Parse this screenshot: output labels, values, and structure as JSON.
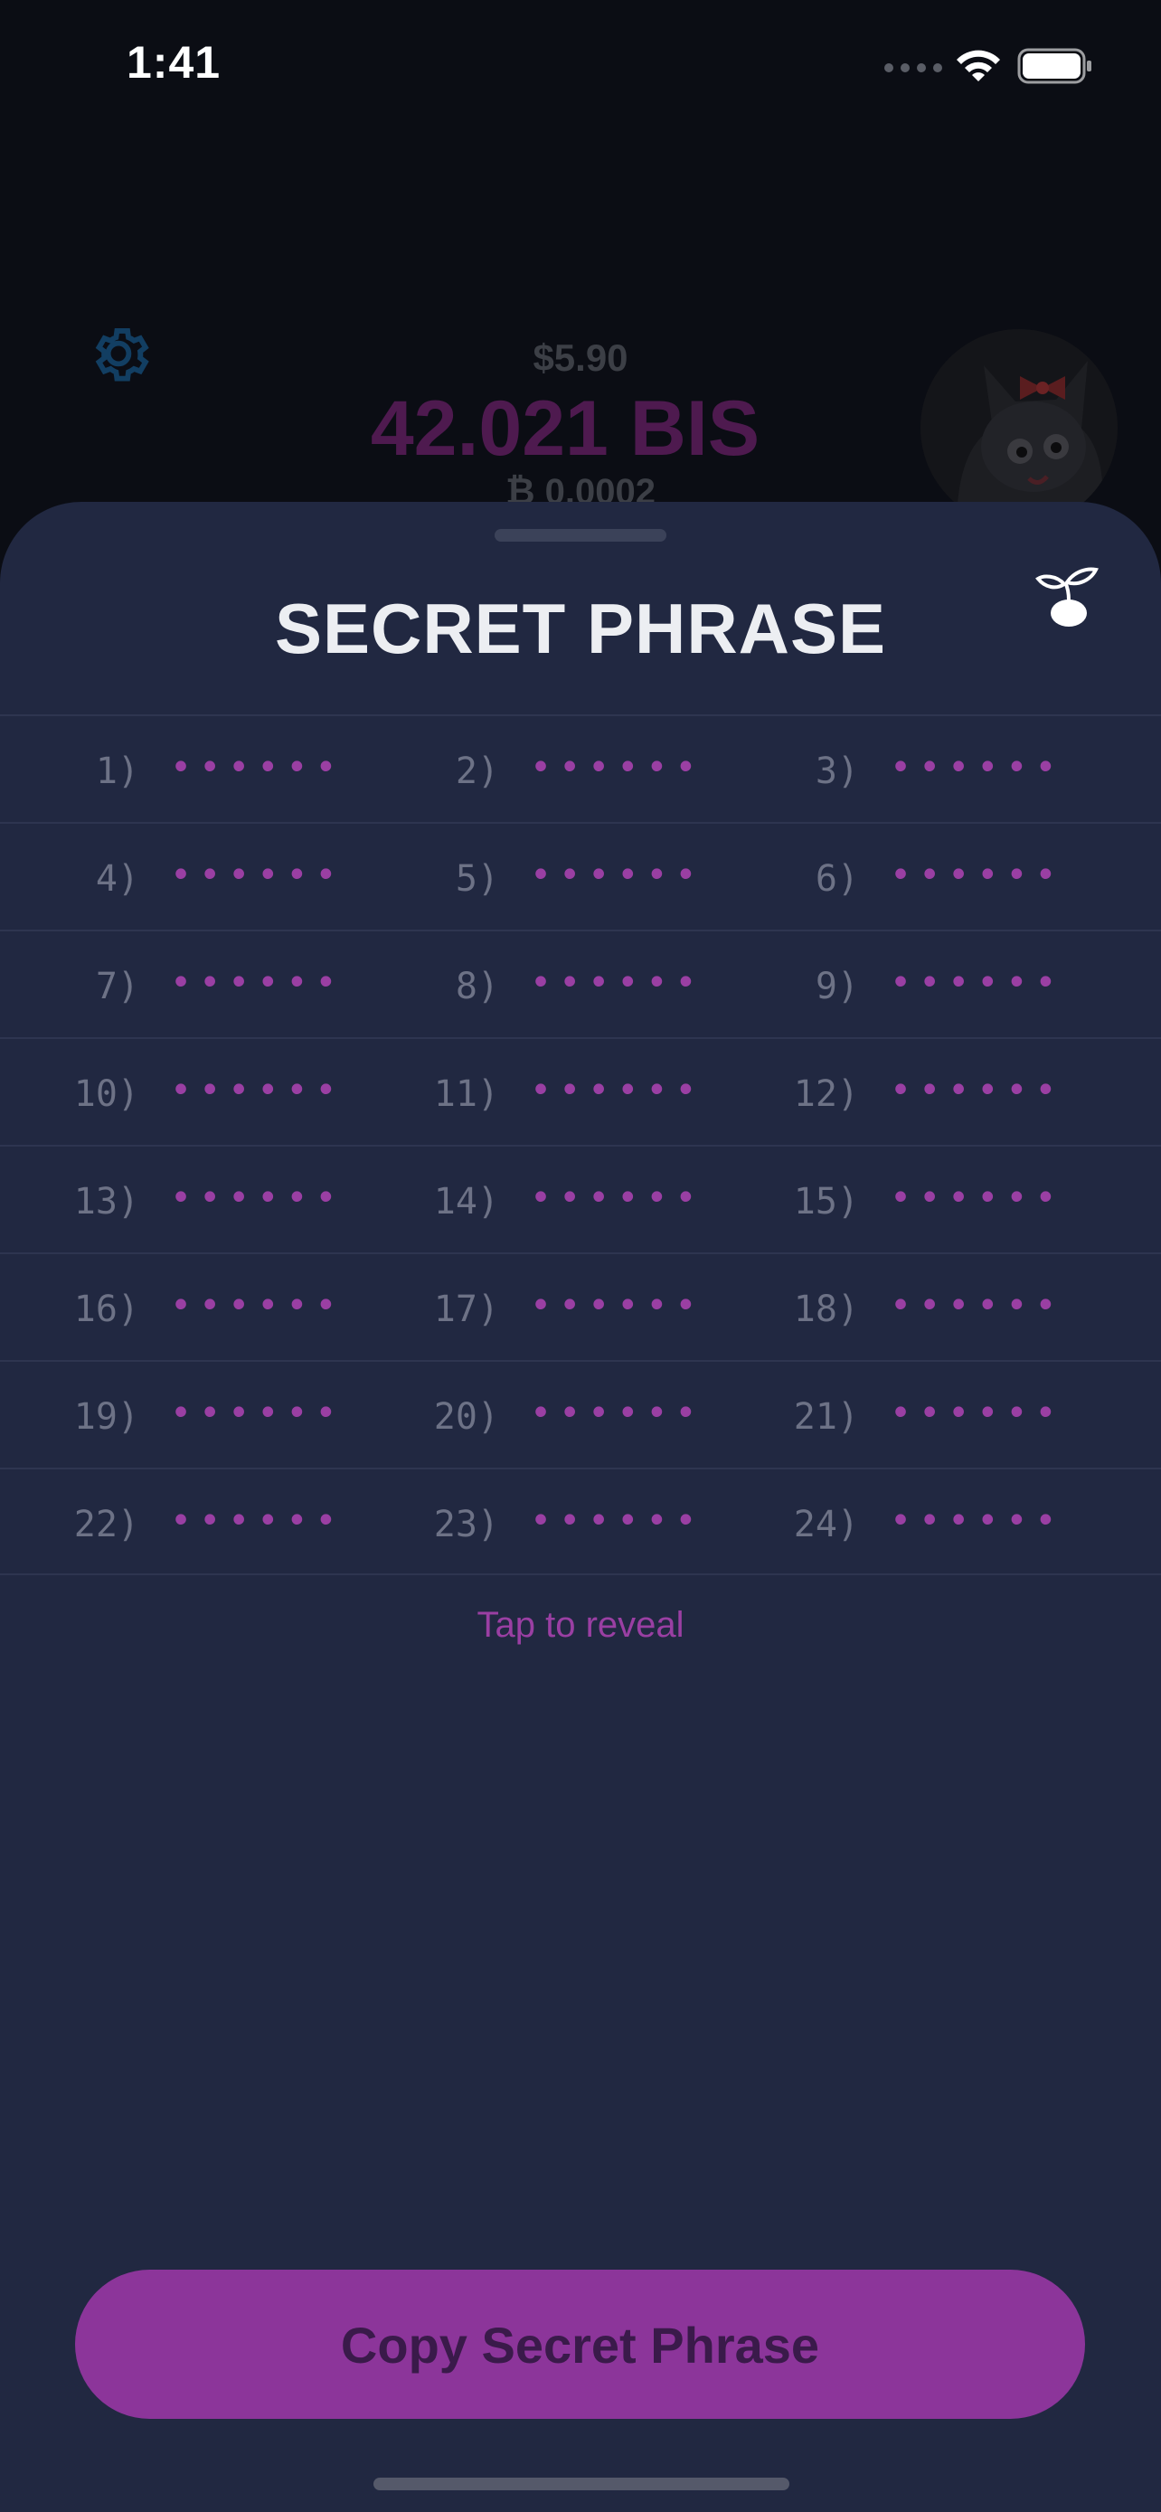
{
  "status_bar": {
    "time": "1:41"
  },
  "header": {
    "fiat_balance": "$5.90",
    "token_balance": "42.021 BIS",
    "btc_balance": "₿ 0.0002"
  },
  "sheet": {
    "title": "SECRET PHRASE",
    "words": [
      {
        "label": "1)",
        "value": "••••••"
      },
      {
        "label": "2)",
        "value": "••••••"
      },
      {
        "label": "3)",
        "value": "••••••"
      },
      {
        "label": "4)",
        "value": "••••••"
      },
      {
        "label": "5)",
        "value": "••••••"
      },
      {
        "label": "6)",
        "value": "••••••"
      },
      {
        "label": "7)",
        "value": "••••••"
      },
      {
        "label": "8)",
        "value": "••••••"
      },
      {
        "label": "9)",
        "value": "••••••"
      },
      {
        "label": "10)",
        "value": "••••••"
      },
      {
        "label": "11)",
        "value": "••••••"
      },
      {
        "label": "12)",
        "value": "••••••"
      },
      {
        "label": "13)",
        "value": "••••••"
      },
      {
        "label": "14)",
        "value": "••••••"
      },
      {
        "label": "15)",
        "value": "••••••"
      },
      {
        "label": "16)",
        "value": "••••••"
      },
      {
        "label": "17)",
        "value": "••••••"
      },
      {
        "label": "18)",
        "value": "••••••"
      },
      {
        "label": "19)",
        "value": "••••••"
      },
      {
        "label": "20)",
        "value": "••••••"
      },
      {
        "label": "21)",
        "value": "••••••"
      },
      {
        "label": "22)",
        "value": "••••••"
      },
      {
        "label": "23)",
        "value": "••••••"
      },
      {
        "label": "24)",
        "value": "••••••"
      }
    ],
    "reveal_hint": "Tap to reveal",
    "copy_button_label": "Copy Secret Phrase"
  },
  "icons": {
    "settings": "gear-icon",
    "seed": "sprout-icon",
    "wifi": "wifi-icon",
    "battery": "battery-icon",
    "avatar": "avatar-image"
  },
  "colors": {
    "sheet_background": "#212841",
    "accent": "#9a3fa3",
    "button": "#8c359a"
  }
}
